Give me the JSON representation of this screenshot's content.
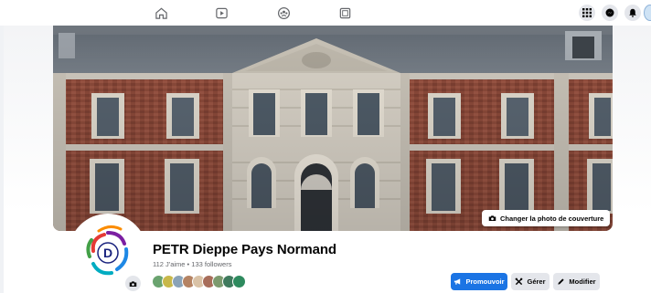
{
  "nav": {
    "icons": [
      "home-icon",
      "watch-icon",
      "groups-icon",
      "gaming-icon"
    ],
    "right_icons": [
      "menu-grid-icon",
      "messenger-icon",
      "notifications-icon"
    ]
  },
  "cover": {
    "change_label": "Changer la photo de couverture"
  },
  "page": {
    "name": "PETR Dieppe Pays Normand",
    "stats": "112 J'aime • 133 followers"
  },
  "actions": {
    "promote_label": "Promouvoir",
    "manage_label": "Gérer",
    "edit_label": "Modifier"
  },
  "colors": {
    "primary": "#1b74e4",
    "grey_button": "#e4e6eb",
    "secondary_text": "#65676b"
  }
}
